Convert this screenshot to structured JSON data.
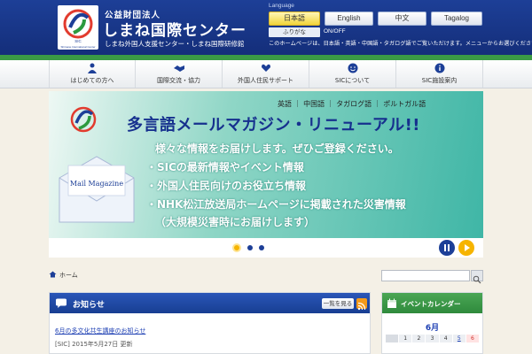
{
  "header": {
    "org_small": "公益財団法人",
    "org_main": "しまね国際センター",
    "org_sub": "しまね外国人支援センター・しまね国際研修館",
    "logo_text": "SIC",
    "logo_caption": "Shimane International Center",
    "language_label": "Language",
    "languages": [
      "日本語",
      "English",
      "中文",
      "Tagalog"
    ],
    "active_language": "日本語",
    "toggle_button": "ふりがな",
    "toggle_text": "ON/OFF",
    "notice": "このホームページは、日本語・英語・中国語・タガログ語でご覧いただけます。メニューからお選びください。"
  },
  "nav": {
    "items": [
      {
        "label": "はじめての方へ",
        "icon": "person-icon"
      },
      {
        "label": "国際交流・協力",
        "icon": "handshake-icon"
      },
      {
        "label": "外国人住民サポート",
        "icon": "heart-hands-icon"
      },
      {
        "label": "SICについて",
        "icon": "smile-icon"
      },
      {
        "label": "SIC施設案内",
        "icon": "info-icon"
      }
    ]
  },
  "banner": {
    "languages": "英語 ｜ 中国語 ｜ タガログ語 ｜ ポルトガル語",
    "title": "多言語メールマガジン・リニューアル!!",
    "lead": "様々な情報をお届けします。ぜひご登録ください。",
    "bullets": [
      "・SICの最新情報やイベント情報",
      "・外国人住民向けのお役立ち情報",
      "・NHK松江放送局ホームページに掲載された災害情報"
    ],
    "note": "（大規模災害時にお届けします）",
    "envelope_label": "Mail Magazine"
  },
  "slider": {
    "slide_count": 3,
    "current_slide": 1
  },
  "breadcrumb": {
    "home": "ホーム"
  },
  "search": {
    "placeholder": ""
  },
  "news": {
    "title": "お知らせ",
    "list_button": "一覧を見る",
    "item_link": "6月の多文化共生講座のお知らせ",
    "item_meta": "[SIC]  2015年5月27日 更新"
  },
  "calendar": {
    "title": "イベントカレンダー",
    "month": "6月",
    "week_row": [
      "",
      "1",
      "2",
      "3",
      "4",
      "5",
      "6"
    ],
    "highlight": "6",
    "link_day": "5"
  },
  "colors": {
    "header_blue": "#1d3f97",
    "nav_green": "#3a9a45",
    "accent_yellow": "#f6b400"
  }
}
